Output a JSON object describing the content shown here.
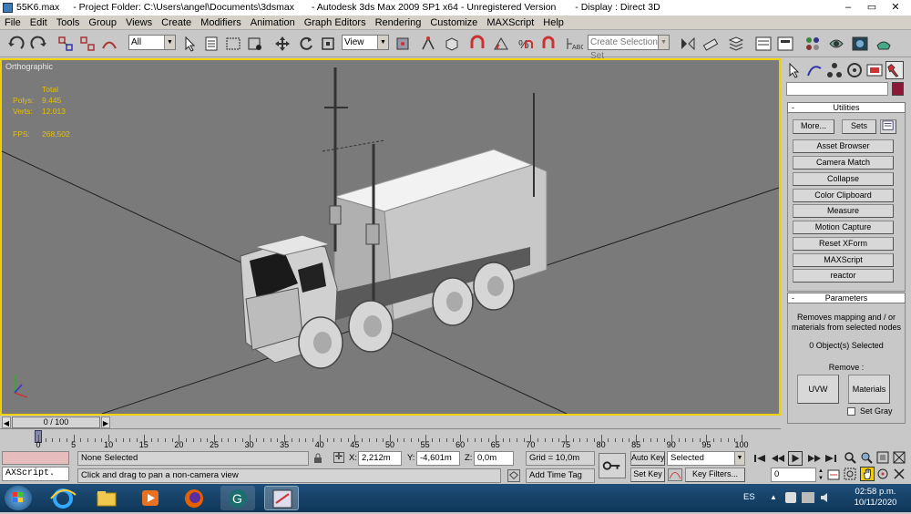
{
  "window": {
    "file": "55K6.max",
    "project": "- Project Folder: C:\\Users\\angel\\Documents\\3dsmax",
    "app": "- Autodesk 3ds Max  2009 SP1  x64  - Unregistered Version",
    "display": "- Display : Direct 3D",
    "min": "–",
    "max": "▭",
    "close": "✕"
  },
  "menu": [
    "File",
    "Edit",
    "Tools",
    "Group",
    "Views",
    "Create",
    "Modifiers",
    "Animation",
    "Graph Editors",
    "Rendering",
    "Customize",
    "MAXScript",
    "Help"
  ],
  "toolbar": {
    "filter_value": "All",
    "refcoord_value": "View",
    "named_sel_placeholder": "Create Selection Set"
  },
  "viewport": {
    "label": "Orthographic",
    "stats_total": "Total",
    "polys_label": "Polys:",
    "polys_value": "9.445",
    "verts_label": "Verts:",
    "verts_value": "12.013",
    "fps_label": "FPS:",
    "fps_value": "268,502"
  },
  "command_panel": {
    "utilities_title": "Utilities",
    "more_label": "More...",
    "sets_label": "Sets",
    "utilities": [
      "Asset Browser",
      "Camera Match",
      "Collapse",
      "Color Clipboard",
      "Measure",
      "Motion Capture",
      "Reset XForm",
      "MAXScript",
      "reactor"
    ],
    "parameters_title": "Parameters",
    "param_desc": "Removes mapping and / or materials from selected nodes",
    "selected_text": "0 Object(s) Selected",
    "remove_label": "Remove :",
    "uvw_label": "UVW",
    "materials_label": "Materials",
    "setgray_label": "Set Gray"
  },
  "timeline": {
    "frame_display": "0 / 100",
    "ticks": [
      "0",
      "5",
      "10",
      "15",
      "20",
      "25",
      "30",
      "35",
      "40",
      "45",
      "50",
      "55",
      "60",
      "65",
      "70",
      "75",
      "80",
      "85",
      "90",
      "95",
      "100"
    ]
  },
  "status": {
    "none_selected": "None Selected",
    "prompt": "Click and drag to pan a non-camera view",
    "x_label": "X:",
    "x_value": "2,212m",
    "y_label": "Y:",
    "y_value": "-4,601m",
    "z_label": "Z:",
    "z_value": "0,0m",
    "grid": "Grid = 10,0m",
    "add_time_tag": "Add Time Tag",
    "autokey": "Auto Key",
    "setkey": "Set Key",
    "selected_dropdown": "Selected",
    "key_filters": "Key Filters...",
    "frame_value": "0",
    "maxscript_label": "AXScript."
  },
  "taskbar": {
    "lang": "ES",
    "time": "02:58 p.m.",
    "date": "10/11/2020"
  },
  "colors": {
    "viewport_border": "#f0d000",
    "viewport_bg": "#7a7a7a",
    "stats": "#e8c000",
    "taskbar": "#1f4f7a"
  }
}
